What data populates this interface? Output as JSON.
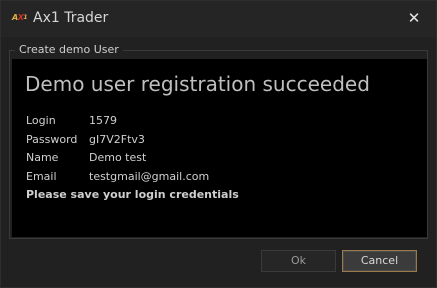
{
  "window": {
    "title": "Ax1 Trader",
    "logo_text": "Ax1",
    "close_glyph": "✕"
  },
  "group": {
    "legend": "Create demo User"
  },
  "content": {
    "heading": "Demo user registration succeeded",
    "fields": [
      {
        "label": "Login",
        "value": "1579"
      },
      {
        "label": "Password",
        "value": "gI7V2Ftv3"
      },
      {
        "label": "Name",
        "value": "Demo test"
      },
      {
        "label": "Email",
        "value": "testgmail@gmail.com"
      }
    ],
    "notice": "Please save your login credentials"
  },
  "buttons": {
    "ok": "Ok",
    "cancel": "Cancel"
  }
}
